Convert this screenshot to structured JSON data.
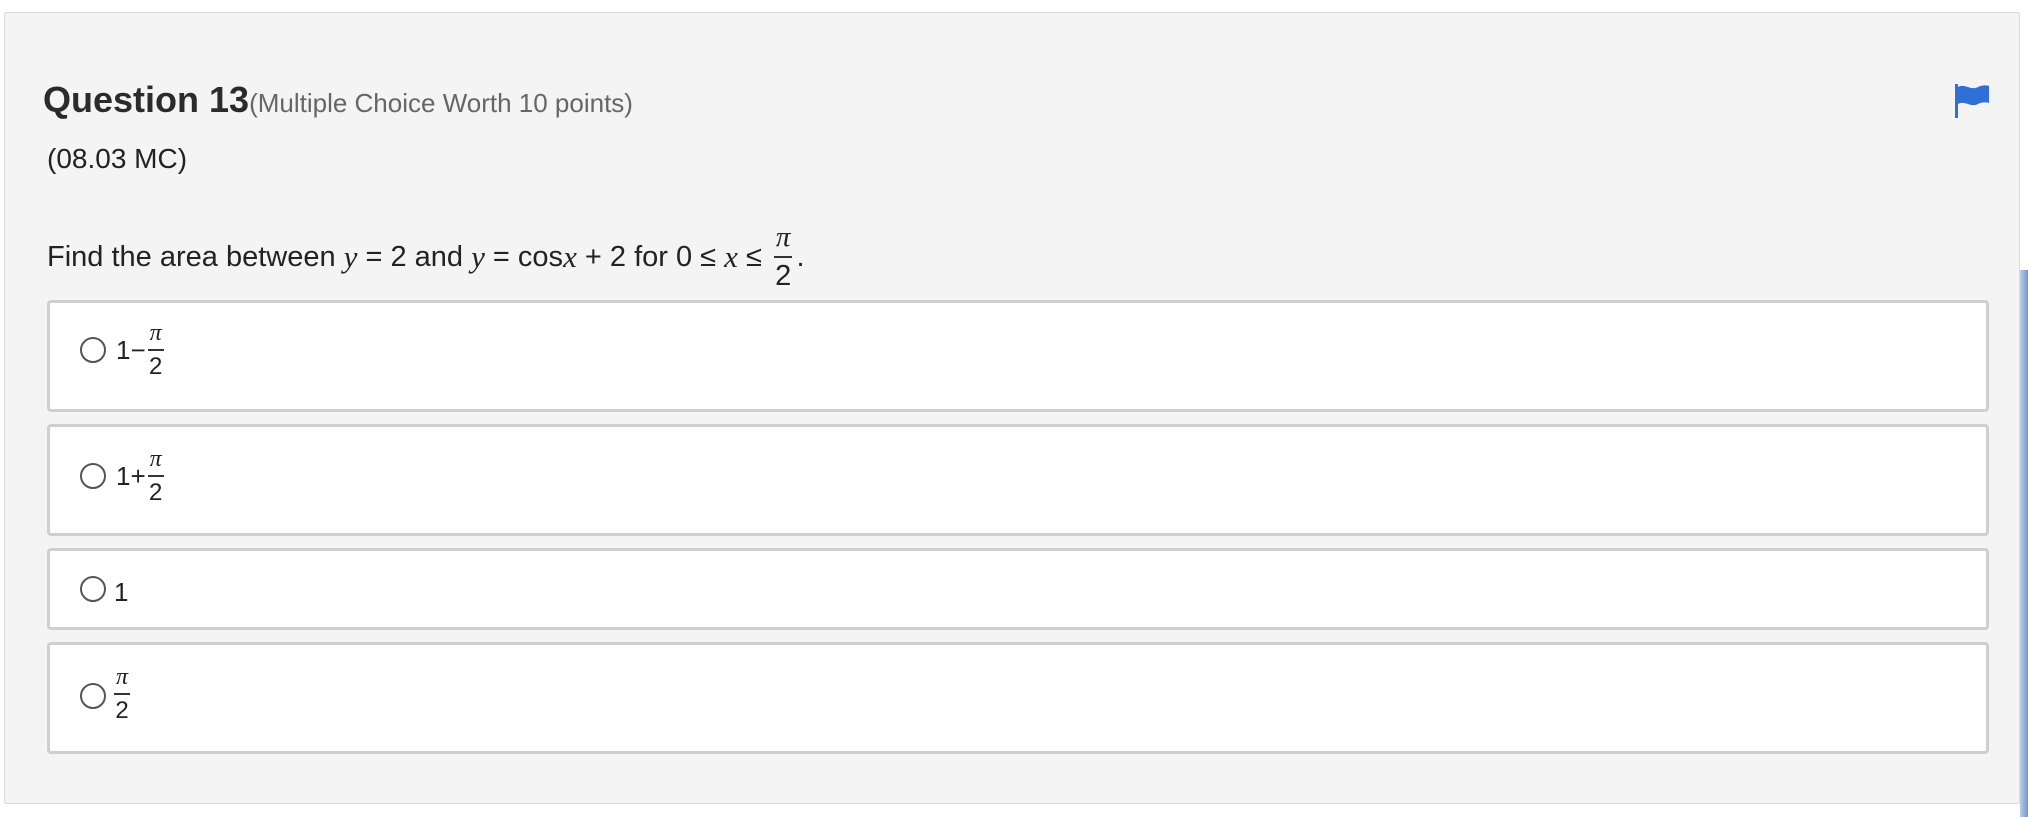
{
  "question": {
    "title": "Question 13",
    "meta": "(Multiple Choice Worth 10 points)",
    "code": "(08.03 MC)",
    "flag_icon": "flag-icon",
    "flag_color": "#2f6fd6"
  },
  "prompt": {
    "p1": "Find the area between ",
    "y1": "y",
    "p2": " = 2 and ",
    "y2": "y",
    "p3": " = cos",
    "x1": "x",
    "p4": " + 2 for 0 ≤ ",
    "x2": "x",
    "p5": " ≤ ",
    "frac_num": "π",
    "frac_den": "2",
    "end": "."
  },
  "options": [
    {
      "lead": "1−",
      "num": "π",
      "den": "2"
    },
    {
      "lead": "1+",
      "num": "π",
      "den": "2"
    },
    {
      "text": "1"
    },
    {
      "num": "π",
      "den": "2"
    }
  ]
}
